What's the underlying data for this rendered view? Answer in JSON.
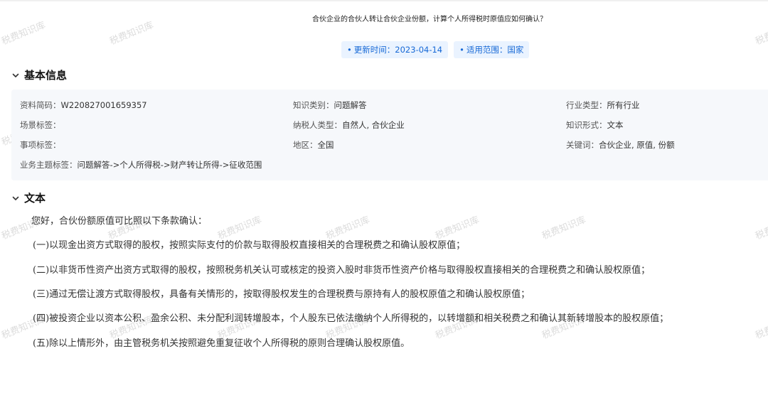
{
  "watermark_text": "税费知识库",
  "article": {
    "title": "合伙企业的合伙人转让合伙企业份额，计算个人所得税时原值应如何确认？",
    "tags": [
      {
        "text": "更新时间：2023-04-14"
      },
      {
        "text": "适用范围：国家"
      }
    ]
  },
  "basic_info": {
    "heading": "基本信息",
    "fields": [
      {
        "label": "资料简码：",
        "value": "W220827001659357"
      },
      {
        "label": "知识类别：",
        "value": "问题解答"
      },
      {
        "label": "行业类型：",
        "value": "所有行业"
      },
      {
        "label": "场景标签：",
        "value": ""
      },
      {
        "label": "纳税人类型：",
        "value": "自然人, 合伙企业"
      },
      {
        "label": "知识形式：",
        "value": "文本"
      },
      {
        "label": "事项标签：",
        "value": ""
      },
      {
        "label": "地区：",
        "value": "全国"
      },
      {
        "label": "关键词：",
        "value": "合伙企业, 原值, 份额"
      },
      {
        "label": "业务主题标签：",
        "value": "问题解答->个人所得税->财产转让所得->征收范围"
      }
    ]
  },
  "text_section": {
    "heading": "文本",
    "paragraphs": [
      "您好，合伙份额原值可比照以下条款确认：",
      "(一)以现金出资方式取得的股权，按照实际支付的价款与取得股权直接相关的合理税费之和确认股权原值；",
      "(二)以非货币性资产出资方式取得的股权，按照税务机关认可或核定的投资入股时非货币性资产价格与取得股权直接相关的合理税费之和确认股权原值；",
      "(三)通过无偿让渡方式取得股权，具备有关情形的，按取得股权发生的合理税费与原持有人的股权原值之和确认股权原值；",
      "(四)被投资企业以资本公积、盈余公积、未分配利润转增股本，个人股东已依法缴纳个人所得税的，以转增额和相关税费之和确认其新转增股本的股权原值；",
      "(五)除以上情形外，由主管税务机关按照避免重复征收个人所得税的原则合理确认股权原值。"
    ]
  },
  "icons": {
    "section_toggle": "chevron-down-icon",
    "tag_bullet": "dot-icon"
  }
}
